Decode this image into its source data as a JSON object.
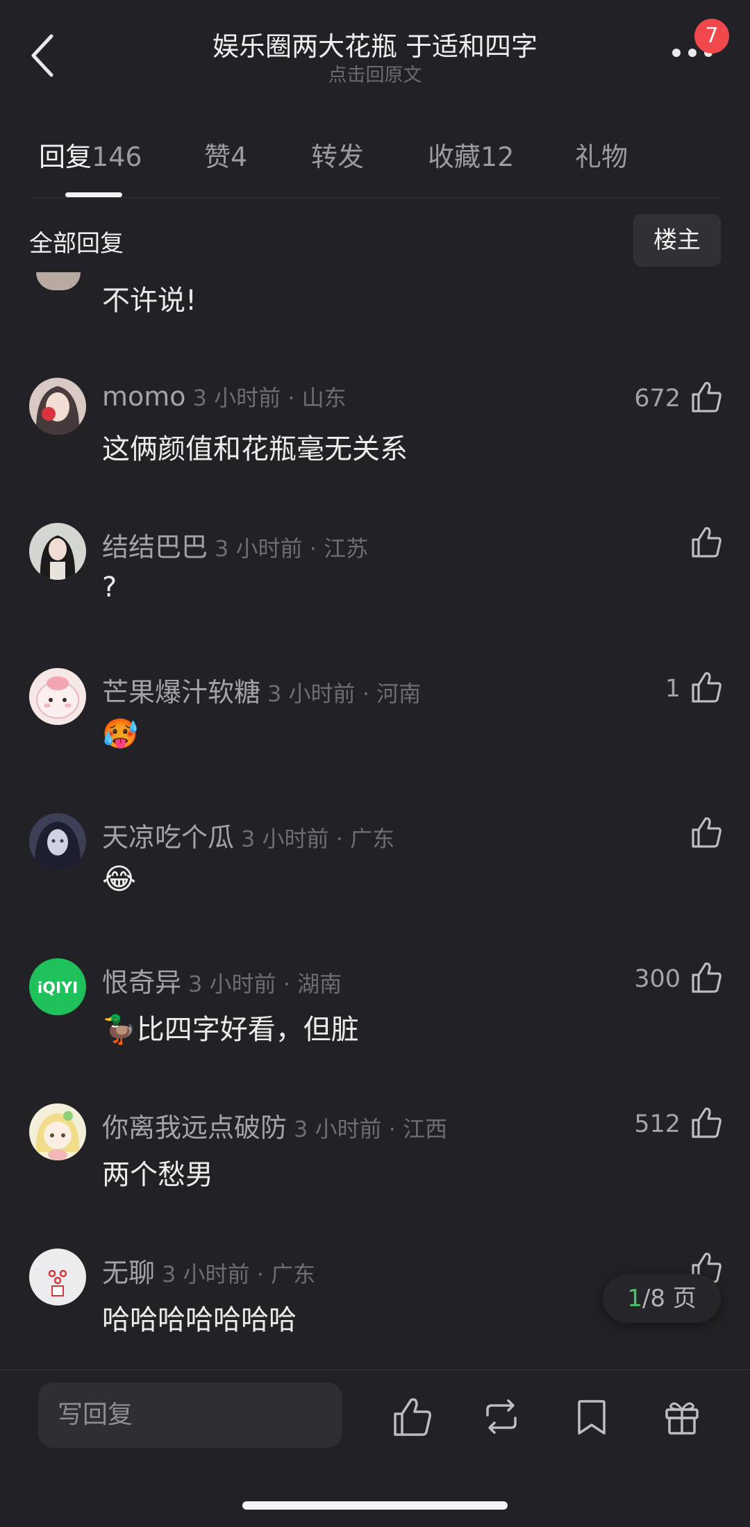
{
  "header": {
    "title": "娱乐圈两大花瓶  于适和四字",
    "subtitle": "点击回原文",
    "notification_count": "7"
  },
  "tabs": [
    {
      "label": "回复",
      "count": "146",
      "active": true
    },
    {
      "label": "赞",
      "count": "4",
      "active": false
    },
    {
      "label": "转发",
      "count": "",
      "active": false
    },
    {
      "label": "收藏",
      "count": "12",
      "active": false
    },
    {
      "label": "礼物",
      "count": "",
      "active": false
    }
  ],
  "section": {
    "title": "全部回复",
    "filter_button": "楼主"
  },
  "partial_comment": {
    "text": "不许说!"
  },
  "comments": [
    {
      "username": "momo",
      "time_location": "3 小时前 · 山东",
      "text": "这俩颜值和花瓶毫无关系",
      "likes": "672"
    },
    {
      "username": "结结巴巴",
      "time_location": "3 小时前 · 江苏",
      "text": "?",
      "likes": ""
    },
    {
      "username": "芒果爆汁软糖",
      "time_location": "3 小时前 · 河南",
      "text": "🥵",
      "likes": "1"
    },
    {
      "username": "天凉吃个瓜",
      "time_location": "3 小时前 · 广东",
      "text": "😂",
      "likes": ""
    },
    {
      "username": "恨奇异",
      "time_location": "3 小时前 · 湖南",
      "text": "🦆比四字好看，但脏",
      "likes": "300"
    },
    {
      "username": "你离我远点破防",
      "time_location": "3 小时前 · 江西",
      "text": "两个愁男",
      "likes": "512"
    },
    {
      "username": "无聊",
      "time_location": "3 小时前 · 广东",
      "text": "哈哈哈哈哈哈哈",
      "likes": ""
    }
  ],
  "avatar_labels": {
    "iqiyi": "iQIYI"
  },
  "pager": {
    "current": "1",
    "total_label": "/8 页"
  },
  "bottom_bar": {
    "reply_placeholder": "写回复"
  },
  "colors": {
    "background": "#222226",
    "badge": "#f0484c",
    "pager_current": "#4cc36a",
    "iqiyi_green": "#1fc15b"
  }
}
